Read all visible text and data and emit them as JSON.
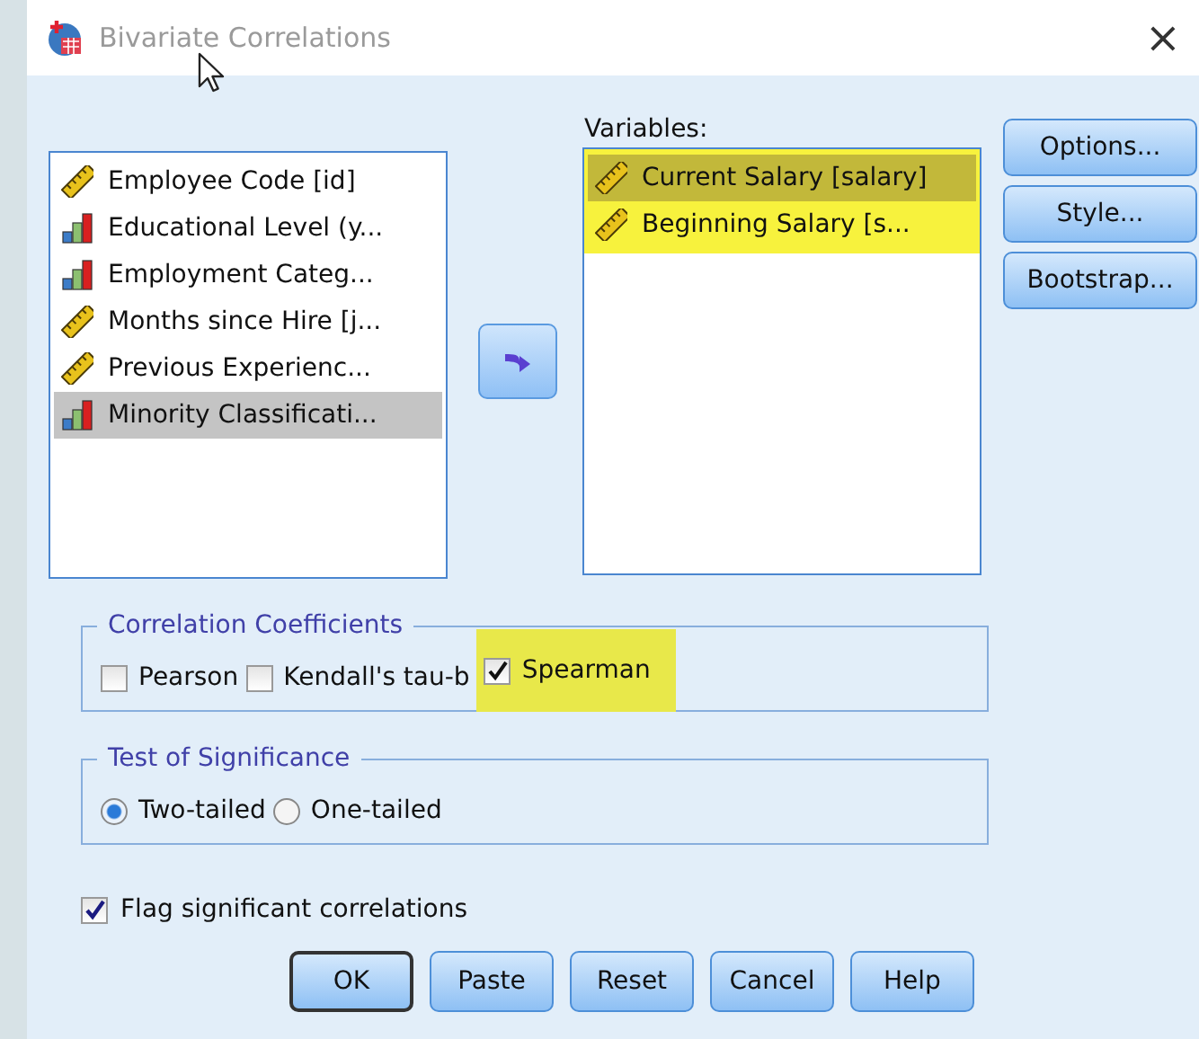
{
  "window": {
    "title": "Bivariate Correlations",
    "close": "×"
  },
  "source_list": {
    "items": [
      {
        "label": "Employee Code [id]",
        "kind": "scale",
        "selected": false
      },
      {
        "label": "Educational Level (y...",
        "kind": "ordinal",
        "selected": false
      },
      {
        "label": "Employment Categ...",
        "kind": "ordinal",
        "selected": false
      },
      {
        "label": "Months since Hire [j...",
        "kind": "scale",
        "selected": false
      },
      {
        "label": "Previous Experienc...",
        "kind": "scale",
        "selected": false
      },
      {
        "label": "Minority Classificati...",
        "kind": "ordinal",
        "selected": true
      }
    ]
  },
  "variables": {
    "label": "Variables:",
    "highlighted": true,
    "items": [
      {
        "label": "Current Salary [salary]",
        "kind": "scale",
        "selected": true
      },
      {
        "label": "Beginning Salary [s...",
        "kind": "scale",
        "selected": false
      }
    ]
  },
  "side_buttons": [
    {
      "label": "Options..."
    },
    {
      "label": "Style..."
    },
    {
      "label": "Bootstrap..."
    }
  ],
  "correlation_coefficients": {
    "title": "Correlation Coefficients",
    "options": [
      {
        "label": "Pearson",
        "checked": false,
        "highlighted": false
      },
      {
        "label": "Kendall's tau-b",
        "checked": false,
        "highlighted": false
      },
      {
        "label": "Spearman",
        "checked": true,
        "highlighted": true
      }
    ]
  },
  "test_of_significance": {
    "title": "Test of Significance",
    "options": [
      {
        "label": "Two-tailed",
        "selected": true
      },
      {
        "label": "One-tailed",
        "selected": false
      }
    ]
  },
  "flag": {
    "label": "Flag significant correlations",
    "checked": true
  },
  "buttons": [
    {
      "label": "OK",
      "default": true
    },
    {
      "label": "Paste",
      "default": false
    },
    {
      "label": "Reset",
      "default": false
    },
    {
      "label": "Cancel",
      "default": false
    },
    {
      "label": "Help",
      "default": false
    }
  ]
}
